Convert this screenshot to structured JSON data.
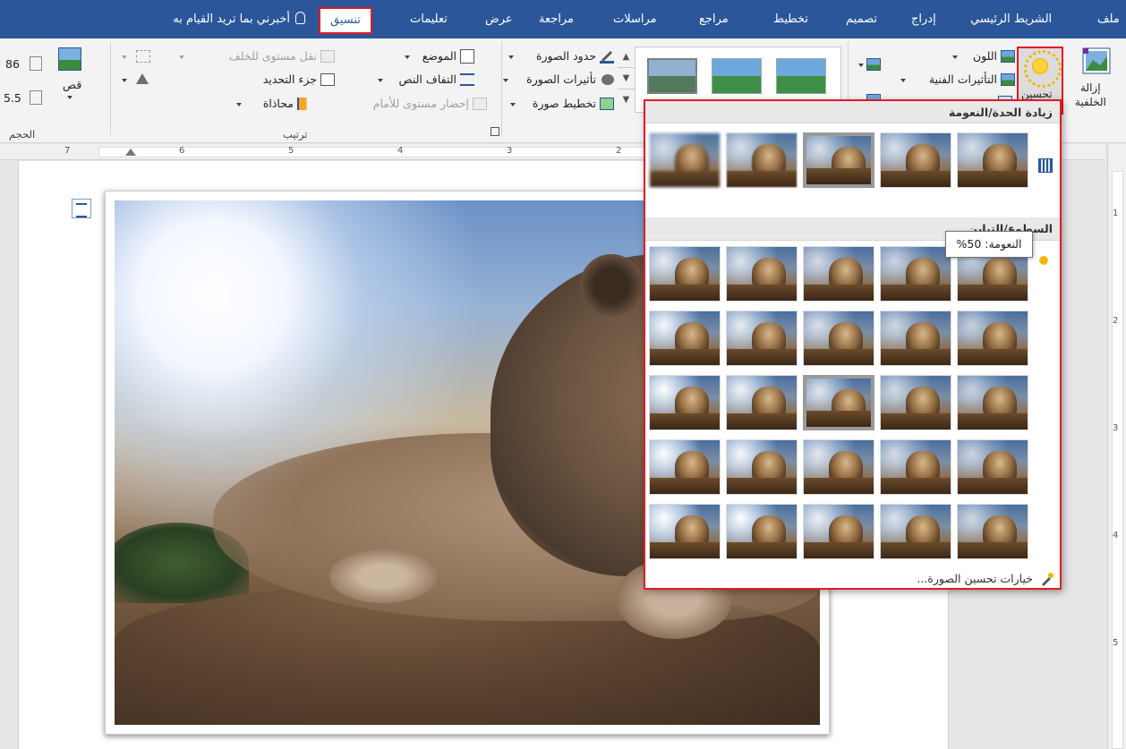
{
  "tabs": {
    "file": "ملف",
    "home": "الشريط الرئيسي",
    "insert": "إدراج",
    "design": "تصميم",
    "layout": "تخطيط",
    "references": "مراجع",
    "mailings": "مراسلات",
    "review": "مراجعة",
    "view": "عرض",
    "help": "تعليمات",
    "format": "تنسيق",
    "tell_me": "أخبرني بما تريد القيام به"
  },
  "ribbon": {
    "remove_background": [
      "إزالة",
      "الخلفية"
    ],
    "corrections": "تحسين",
    "color": "اللون",
    "artistic_effects": "التأثيرات الفنية",
    "picture_border": "حدود الصورة",
    "picture_effects": "تأثيرات الصورة",
    "picture_layout": "تخطيط صورة",
    "position": "الموضع",
    "wrap_text": "التفاف النص",
    "bring_forward": "إحضار مستوى للأمام",
    "send_backward": "نقل مستوى للخلف",
    "selection_pane": "جزء التحديد",
    "align": "محاذاة",
    "crop": "قص",
    "height_value": "86",
    "width_value": "5.5",
    "arrange_group": "ترتيب",
    "size_group": "الحجم"
  },
  "ruler": {
    "h_numbers": [
      "7",
      "6",
      "5",
      "4",
      "3",
      "2"
    ],
    "v_numbers": [
      "1",
      "2",
      "3",
      "4",
      "5"
    ]
  },
  "gallery": {
    "section_sharpen": "زيادة الحدة/النعومة",
    "section_brightness": "السطوع/التباين",
    "tooltip": "النعومة: 50%",
    "footer": "خيارات تحسين الصورة...",
    "sharpen_row": [
      {
        "blur": 1.6,
        "selected": false
      },
      {
        "blur": 0.9,
        "selected": false
      },
      {
        "blur": 0.3,
        "selected": true
      },
      {
        "blur": 0,
        "selected": false
      },
      {
        "blur": 0,
        "selected": false
      }
    ],
    "brightness_grid": [
      [
        0.25,
        0.18,
        0.1,
        0.05,
        0.0
      ],
      [
        0.35,
        0.25,
        0.15,
        0.08,
        0.02
      ],
      [
        0.4,
        0.3,
        0.2,
        0.1,
        0.03
      ],
      [
        0.45,
        0.35,
        0.22,
        0.12,
        0.05
      ],
      [
        0.5,
        0.4,
        0.28,
        0.18,
        0.08
      ]
    ],
    "brightness_selected": [
      2,
      2
    ]
  },
  "colors": {
    "brand": "#2b579a",
    "highlight": "#e01b24"
  }
}
